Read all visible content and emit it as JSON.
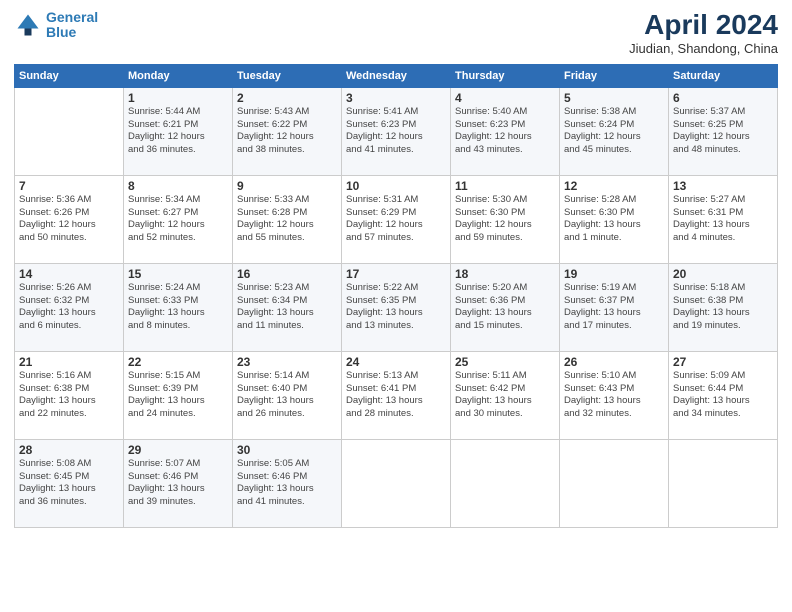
{
  "header": {
    "logo_line1": "General",
    "logo_line2": "Blue",
    "month_title": "April 2024",
    "location": "Jiudian, Shandong, China"
  },
  "days_of_week": [
    "Sunday",
    "Monday",
    "Tuesday",
    "Wednesday",
    "Thursday",
    "Friday",
    "Saturday"
  ],
  "weeks": [
    [
      {
        "num": "",
        "info": ""
      },
      {
        "num": "1",
        "info": "Sunrise: 5:44 AM\nSunset: 6:21 PM\nDaylight: 12 hours\nand 36 minutes."
      },
      {
        "num": "2",
        "info": "Sunrise: 5:43 AM\nSunset: 6:22 PM\nDaylight: 12 hours\nand 38 minutes."
      },
      {
        "num": "3",
        "info": "Sunrise: 5:41 AM\nSunset: 6:23 PM\nDaylight: 12 hours\nand 41 minutes."
      },
      {
        "num": "4",
        "info": "Sunrise: 5:40 AM\nSunset: 6:23 PM\nDaylight: 12 hours\nand 43 minutes."
      },
      {
        "num": "5",
        "info": "Sunrise: 5:38 AM\nSunset: 6:24 PM\nDaylight: 12 hours\nand 45 minutes."
      },
      {
        "num": "6",
        "info": "Sunrise: 5:37 AM\nSunset: 6:25 PM\nDaylight: 12 hours\nand 48 minutes."
      }
    ],
    [
      {
        "num": "7",
        "info": "Sunrise: 5:36 AM\nSunset: 6:26 PM\nDaylight: 12 hours\nand 50 minutes."
      },
      {
        "num": "8",
        "info": "Sunrise: 5:34 AM\nSunset: 6:27 PM\nDaylight: 12 hours\nand 52 minutes."
      },
      {
        "num": "9",
        "info": "Sunrise: 5:33 AM\nSunset: 6:28 PM\nDaylight: 12 hours\nand 55 minutes."
      },
      {
        "num": "10",
        "info": "Sunrise: 5:31 AM\nSunset: 6:29 PM\nDaylight: 12 hours\nand 57 minutes."
      },
      {
        "num": "11",
        "info": "Sunrise: 5:30 AM\nSunset: 6:30 PM\nDaylight: 12 hours\nand 59 minutes."
      },
      {
        "num": "12",
        "info": "Sunrise: 5:28 AM\nSunset: 6:30 PM\nDaylight: 13 hours\nand 1 minute."
      },
      {
        "num": "13",
        "info": "Sunrise: 5:27 AM\nSunset: 6:31 PM\nDaylight: 13 hours\nand 4 minutes."
      }
    ],
    [
      {
        "num": "14",
        "info": "Sunrise: 5:26 AM\nSunset: 6:32 PM\nDaylight: 13 hours\nand 6 minutes."
      },
      {
        "num": "15",
        "info": "Sunrise: 5:24 AM\nSunset: 6:33 PM\nDaylight: 13 hours\nand 8 minutes."
      },
      {
        "num": "16",
        "info": "Sunrise: 5:23 AM\nSunset: 6:34 PM\nDaylight: 13 hours\nand 11 minutes."
      },
      {
        "num": "17",
        "info": "Sunrise: 5:22 AM\nSunset: 6:35 PM\nDaylight: 13 hours\nand 13 minutes."
      },
      {
        "num": "18",
        "info": "Sunrise: 5:20 AM\nSunset: 6:36 PM\nDaylight: 13 hours\nand 15 minutes."
      },
      {
        "num": "19",
        "info": "Sunrise: 5:19 AM\nSunset: 6:37 PM\nDaylight: 13 hours\nand 17 minutes."
      },
      {
        "num": "20",
        "info": "Sunrise: 5:18 AM\nSunset: 6:38 PM\nDaylight: 13 hours\nand 19 minutes."
      }
    ],
    [
      {
        "num": "21",
        "info": "Sunrise: 5:16 AM\nSunset: 6:38 PM\nDaylight: 13 hours\nand 22 minutes."
      },
      {
        "num": "22",
        "info": "Sunrise: 5:15 AM\nSunset: 6:39 PM\nDaylight: 13 hours\nand 24 minutes."
      },
      {
        "num": "23",
        "info": "Sunrise: 5:14 AM\nSunset: 6:40 PM\nDaylight: 13 hours\nand 26 minutes."
      },
      {
        "num": "24",
        "info": "Sunrise: 5:13 AM\nSunset: 6:41 PM\nDaylight: 13 hours\nand 28 minutes."
      },
      {
        "num": "25",
        "info": "Sunrise: 5:11 AM\nSunset: 6:42 PM\nDaylight: 13 hours\nand 30 minutes."
      },
      {
        "num": "26",
        "info": "Sunrise: 5:10 AM\nSunset: 6:43 PM\nDaylight: 13 hours\nand 32 minutes."
      },
      {
        "num": "27",
        "info": "Sunrise: 5:09 AM\nSunset: 6:44 PM\nDaylight: 13 hours\nand 34 minutes."
      }
    ],
    [
      {
        "num": "28",
        "info": "Sunrise: 5:08 AM\nSunset: 6:45 PM\nDaylight: 13 hours\nand 36 minutes."
      },
      {
        "num": "29",
        "info": "Sunrise: 5:07 AM\nSunset: 6:46 PM\nDaylight: 13 hours\nand 39 minutes."
      },
      {
        "num": "30",
        "info": "Sunrise: 5:05 AM\nSunset: 6:46 PM\nDaylight: 13 hours\nand 41 minutes."
      },
      {
        "num": "",
        "info": ""
      },
      {
        "num": "",
        "info": ""
      },
      {
        "num": "",
        "info": ""
      },
      {
        "num": "",
        "info": ""
      }
    ]
  ]
}
